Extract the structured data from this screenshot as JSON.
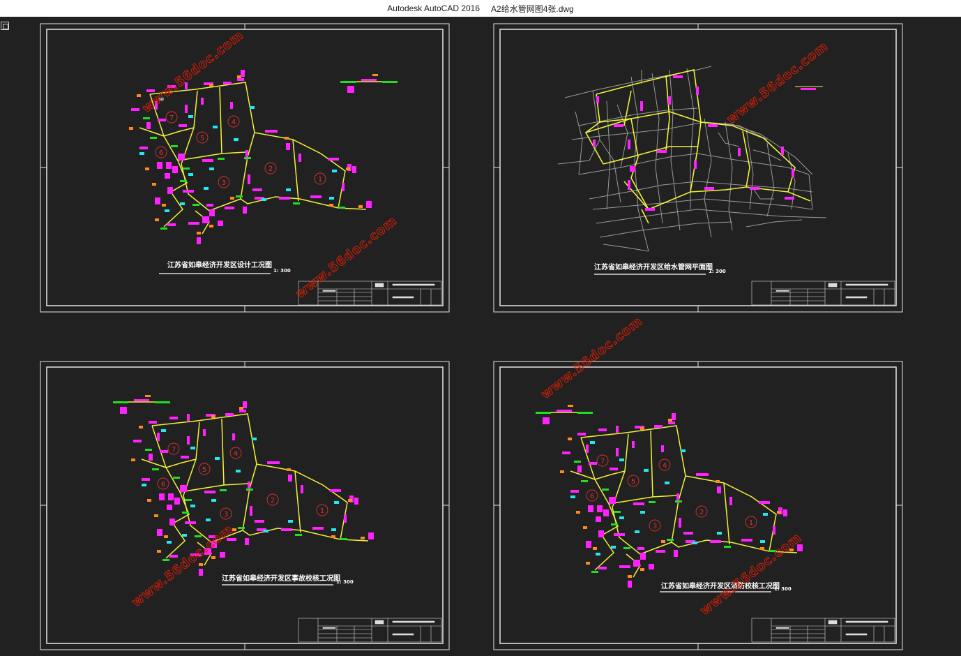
{
  "window": {
    "app_title": "Autodesk AutoCAD 2016",
    "document_title": "A2给水管网图4张.dwg"
  },
  "colors": {
    "background": "#212121",
    "frame": "#e6e6e6",
    "pipe": "#f2f23a",
    "valve": "#ff22ff",
    "cyan_mark": "#22e8f0",
    "green_mark": "#22dd22",
    "orange_mark": "#ff8a1e",
    "street": "#9a9a9a",
    "watermark": "#d81e06"
  },
  "sheets": {
    "top_left": {
      "title": "江苏省如皋经济开发区设计工况图",
      "scale": "1: 300"
    },
    "top_right": {
      "title": "江苏省如皋经济开发区给水管网平面图",
      "scale": "1: 300"
    },
    "bottom_left": {
      "title": "江苏省如皋经济开发区事故校核工况图",
      "scale": "1: 300"
    },
    "bottom_right": {
      "title": "江苏省如皋经济开发区消防校核工况图",
      "scale": "1: 300"
    }
  },
  "zone_numbers": [
    "1",
    "2",
    "3",
    "4",
    "5",
    "6",
    "7"
  ],
  "watermark_text": "www.56doc.com",
  "icons": {
    "corner": "viewport-corner-icon"
  }
}
